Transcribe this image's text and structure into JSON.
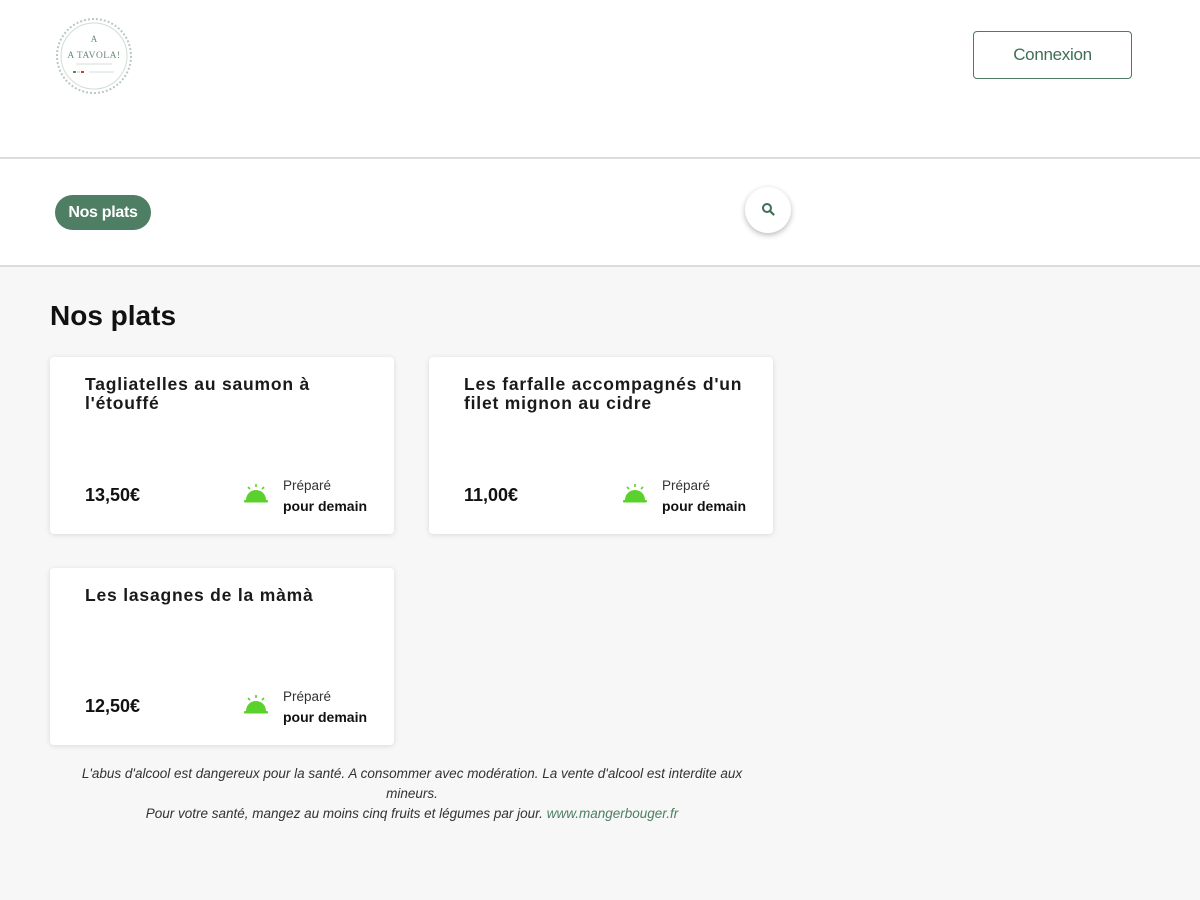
{
  "header": {
    "logo_text": "A TAVOLA!",
    "connexion_label": "Connexion"
  },
  "nav": {
    "tab_label": "Nos plats"
  },
  "main": {
    "title": "Nos plats",
    "dishes": [
      {
        "name": "Tagliatelles au saumon à l'étouffé",
        "price": "13,50€",
        "prep_line1": "Préparé",
        "prep_line2": "pour demain"
      },
      {
        "name": "Les farfalle accompagnés d'un filet mignon au cidre",
        "price": "11,00€",
        "prep_line1": "Préparé",
        "prep_line2": "pour demain"
      },
      {
        "name": "Les lasagnes de la màmà",
        "price": "12,50€",
        "prep_line1": "Préparé",
        "prep_line2": "pour demain"
      }
    ]
  },
  "footer": {
    "line1": "L'abus d'alcool est dangereux pour la santé. A consommer avec modération. La vente d'alcool est interdite aux mineurs.",
    "line2": "Pour votre santé, mangez au moins cinq fruits et légumes par jour.",
    "link": "www.mangerbouger.fr"
  },
  "colors": {
    "brand_green": "#4e7e64",
    "icon_green": "#5bd12e",
    "background": "#f7f7f7"
  },
  "icons": {
    "search": "search-icon",
    "cloche": "cloche-icon"
  }
}
